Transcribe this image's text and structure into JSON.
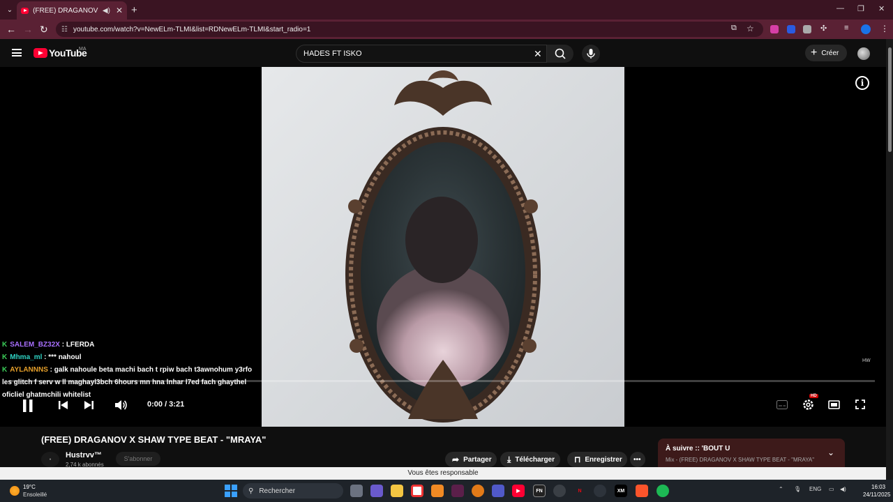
{
  "browser": {
    "tab_title": "(FREE) DRAGANOV X SHAW",
    "url": "youtube.com/watch?v=NewELm-TLMI&list=RDNewELm-TLMI&start_radio=1"
  },
  "youtube": {
    "logo_text": "YouTube",
    "country_code": "MA",
    "search_value": "HADES FT ISKO",
    "create_label": "Créer"
  },
  "player": {
    "chat": [
      {
        "user": "SALEM_BZ32X",
        "user_color": "#a970ff",
        "message": "LFERDA"
      },
      {
        "user": "Mhma_ml",
        "user_color": "#2fd3c4",
        "message": "*** nahoul"
      },
      {
        "user": "AYLANNNS",
        "user_color": "#e6a02a",
        "message": "galk nahoule beta machi bach t rpiw bach t3awnohum y3rfo les glitch f serv w ll maghayl3bch 6hours mn hna lnhar l7ed fach ghaythel oficliel ghatmchili whitelist"
      }
    ],
    "time": "0:00 / 3:21",
    "hd_badge": "HD",
    "watermark": "HW"
  },
  "video": {
    "title": "(FREE) DRAGANOV X SHAW TYPE BEAT - \"MRAYA\"",
    "channel": "Hustrvv™",
    "subscribers": "2,74 k abonnés",
    "subscribe_label": "S'abonner",
    "share_label": "Partager",
    "download_label": "Télécharger",
    "save_label": "Enregistrer"
  },
  "up_next": {
    "title": "À suivre :: 'BOUT U",
    "subtitle": "Mix - (FREE) DRAGANOV X SHAW TYPE BEAT - \"MRAYA\""
  },
  "notice": "Vous êtes responsable",
  "taskbar": {
    "temperature": "19°C",
    "weather": "Ensoleillé",
    "search_label": "Rechercher",
    "lang": "ENG",
    "time": "16:03",
    "date": "24/11/2025"
  }
}
